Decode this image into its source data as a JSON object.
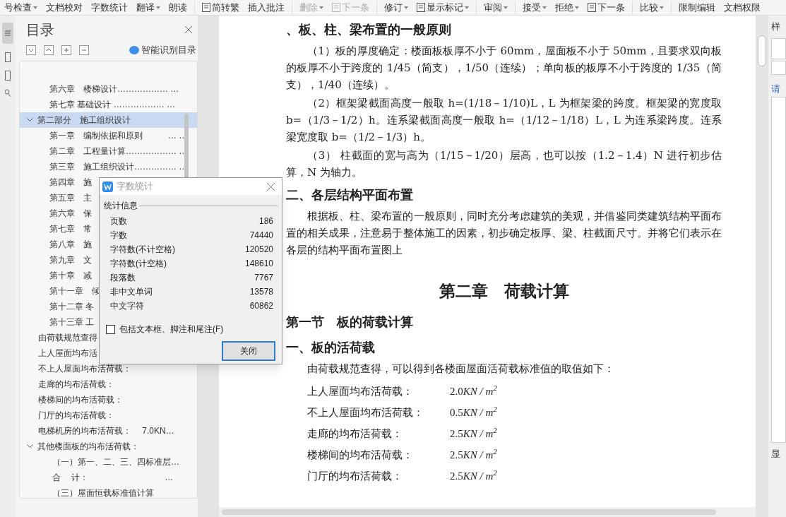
{
  "toolbar": [
    {
      "label": "号检查",
      "dropdown": true,
      "disabled": false,
      "icon": false
    },
    {
      "label": "文档校对",
      "dropdown": false,
      "disabled": false,
      "icon": false
    },
    {
      "label": "字数统计",
      "dropdown": false,
      "disabled": false,
      "icon": false
    },
    {
      "label": "翻译",
      "dropdown": true,
      "disabled": false,
      "icon": false
    },
    {
      "label": "朗读",
      "dropdown": false,
      "disabled": false,
      "icon": false
    },
    {
      "label": "简转繁",
      "dropdown": false,
      "disabled": false,
      "icon": true
    },
    {
      "label": "插入批注",
      "dropdown": false,
      "disabled": false,
      "icon": false
    },
    {
      "label": "删除",
      "dropdown": true,
      "disabled": true,
      "icon": false
    },
    {
      "label": "下一条",
      "dropdown": false,
      "disabled": true,
      "icon": true
    },
    {
      "label": "修订",
      "dropdown": true,
      "disabled": false,
      "icon": false
    },
    {
      "label": "显示标记",
      "dropdown": true,
      "disabled": false,
      "icon": true
    },
    {
      "label": "审阅",
      "dropdown": true,
      "disabled": false,
      "icon": false
    },
    {
      "label": "接受",
      "dropdown": true,
      "disabled": false,
      "icon": false
    },
    {
      "label": "拒绝",
      "dropdown": true,
      "disabled": false,
      "icon": false
    },
    {
      "label": "下一条",
      "dropdown": false,
      "disabled": false,
      "icon": true
    },
    {
      "label": "比较",
      "dropdown": true,
      "disabled": false,
      "icon": false
    },
    {
      "label": "限制编辑",
      "dropdown": false,
      "disabled": false,
      "icon": false
    },
    {
      "label": "文档权限",
      "dropdown": false,
      "disabled": false,
      "icon": false
    }
  ],
  "toc_panel": {
    "title": "目录",
    "smart_button": "智能识别目录",
    "items": [
      {
        "kind": "chapter",
        "text": "第六章　楼梯设计……………… …",
        "selected": false
      },
      {
        "kind": "chapter",
        "text": "第七章 基础设计 ……………… …",
        "selected": false
      },
      {
        "kind": "part",
        "text": "第二部分　施工组织设计",
        "selected": true,
        "expanded": true,
        "children": [
          {
            "text": "第一章　编制依据和原则　　　… …",
            "selected": false
          },
          {
            "text": "第二章　工程量计算……………… …",
            "selected": false
          },
          {
            "text": "第三章　施工组织设计…………… …",
            "selected": false
          },
          {
            "text": "第四章　施",
            "selected": false
          },
          {
            "text": "第五章　主",
            "selected": false
          },
          {
            "text": "第六章　保",
            "selected": false
          },
          {
            "text": "第七章　常",
            "selected": false
          },
          {
            "text": "第八章　施",
            "selected": false
          },
          {
            "text": "第九章　文",
            "selected": false
          },
          {
            "text": "第十章　减",
            "selected": false
          },
          {
            "text": "第十一章　倾",
            "selected": false
          },
          {
            "text": "第十二章 冬",
            "selected": false
          },
          {
            "text": "第十三章 工",
            "selected": false
          }
        ]
      },
      {
        "kind": "entry",
        "text": "由荷载规范查得",
        "selected": false
      },
      {
        "kind": "entry",
        "text": "上人屋面均布活",
        "selected": false
      },
      {
        "kind": "entry",
        "text": "不上人屋面均布活荷载：",
        "selected": false
      },
      {
        "kind": "entry",
        "text": "走廊的均布活荷载：",
        "selected": false
      },
      {
        "kind": "entry",
        "text": "楼梯间的均布活荷载：",
        "selected": false
      },
      {
        "kind": "entry",
        "text": "门厅的均布活荷载：",
        "selected": false
      },
      {
        "kind": "entry",
        "text": "电梯机房的均布活荷载：　 7.0KN…",
        "selected": false
      },
      {
        "kind": "part",
        "text": "其他楼面板的均布活荷载：",
        "selected": false,
        "expanded": true,
        "children": [
          {
            "text": "（一）第一、二、三、四标准层…",
            "selected": false
          },
          {
            "text": "合　 计：　　　　　　　　　…",
            "selected": false
          },
          {
            "text": "（三）屋面恒载标准值计算",
            "selected": false
          }
        ]
      }
    ]
  },
  "dialog": {
    "title": "字数统计",
    "group": "统计信息",
    "rows": [
      {
        "label": "页数",
        "value": "186"
      },
      {
        "label": "字数",
        "value": "74440"
      },
      {
        "label": "字符数(不计空格)",
        "value": "120520"
      },
      {
        "label": "字符数(计空格)",
        "value": "148610"
      },
      {
        "label": "段落数",
        "value": "7767"
      },
      {
        "label": "非中文单词",
        "value": "13578"
      },
      {
        "label": "中文字符",
        "value": "60862"
      }
    ],
    "checkbox": {
      "label": "包括文本框、脚注和尾注(F)",
      "checked": false
    },
    "button": "关闭"
  },
  "document": [
    {
      "kind": "heading",
      "text": "、板、柱、梁布置的一般原则"
    },
    {
      "kind": "para",
      "text": "（1）板的厚度确定：楼面板板厚不小于 60mm，屋面板不小于 50mm，且要求双向板的板厚不小于跨度的 1/45（简支），1/50（连续）；单向板的板厚不小于跨度的 1/35（简支），1/40（连续）。"
    },
    {
      "kind": "para",
      "text": "（2）框架梁截面高度一般取 h=(1/18－1/10)L，L 为框架梁的跨度。框架梁的宽度取 b=（1/3－1/2）h。连系梁截面高度一般取 h=（1/12－1/18）L，L 为连系梁跨度。连系梁宽度取 b=（1/2－1/3）h。"
    },
    {
      "kind": "para",
      "text": "（3） 柱截面的宽与高为（1/15－1/20）层高，也可以按（1.2－1.4）N 进行初步估算，N 为轴力。"
    },
    {
      "kind": "heading",
      "text": "二、各层结构平面布置"
    },
    {
      "kind": "para",
      "text": "根据板、柱、梁布置的一般原则，同时充分考虑建筑的美观，并借鉴同类建筑结构平面布置的相关成果，注意易于整体施工的因素，初步确定板厚、梁、柱截面尺寸。并将它们表示在各层的结构平面布置图上"
    },
    {
      "kind": "chapter",
      "text": "第二章　荷载计算"
    },
    {
      "kind": "heading",
      "text": "第一节　板的荷载计算"
    },
    {
      "kind": "heading",
      "text": "一、板的活荷载"
    },
    {
      "kind": "para",
      "text": "由荷载规范查得，可以得到各楼面屋面活荷载标准值的取值如下："
    },
    {
      "kind": "load",
      "text": "上人屋面均布活荷载：",
      "value": "2.0",
      "unit": "KN / m$^{2}$"
    },
    {
      "kind": "load",
      "text": "不上人屋面均布活荷载：",
      "value": "0.5",
      "unit": "KN / m$^{2}$"
    },
    {
      "kind": "load",
      "text": "走廊的均布活荷载：",
      "value": "2.5",
      "unit": "KN / m$^{2}$"
    },
    {
      "kind": "load",
      "text": "楼梯间的均布活荷载：",
      "value": "2.5",
      "unit": "KN / m$^{2}$"
    },
    {
      "kind": "load",
      "text": "门厅的均布活荷载：",
      "value": "2.5",
      "unit": "KN / m$^{2}$"
    }
  ],
  "right_panel": {
    "top_label": "样",
    "link_label": "请",
    "bottom_label": "显"
  }
}
